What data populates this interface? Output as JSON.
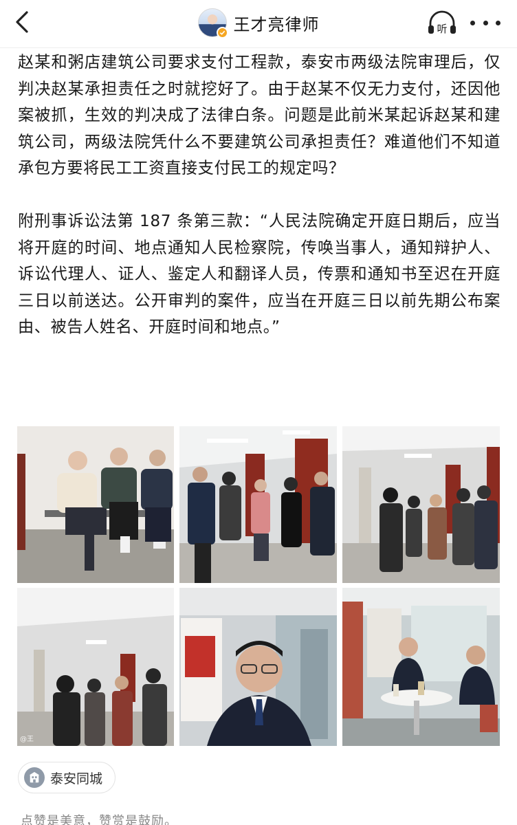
{
  "header": {
    "author_name": "王才亮律师",
    "icons": [
      "back-arrow-icon",
      "avatar",
      "verified-badge-icon",
      "listen-icon",
      "more-icon"
    ],
    "listen_label": "听"
  },
  "article": {
    "paragraphs": [
      "赵某和粥店建筑公司要求支付工程款，泰安市两级法院审理后，仅判决赵某承担责任之时就挖好了。由于赵某不仅无力支付，还因他案被抓，生效的判决成了法律白条。问题是此前米某起诉赵某和建筑公司，两级法院凭什么不要建筑公司承担责任？难道他们不知道承包方要将民工工资直接支付民工的规定吗？",
      "附刑事诉讼法第 187 条第三款：“人民法院确定开庭日期后，应当将开庭的时间、地点通知人民检察院，传唤当事人，通知辩护人、诉讼代理人、证人、鉴定人和翻译人员，传票和通知书至迟在开庭三日以前送达。公开审判的案件，应当在开庭三日以前先期公布案由、被告人姓名、开庭时间和地点。”"
    ]
  },
  "photos": {
    "count": 6,
    "watermark": "@王"
  },
  "location": {
    "label": "泰安同城",
    "icon": "location-building-icon"
  },
  "footer": {
    "text": "点赞是美意，赞赏是鼓励。"
  }
}
